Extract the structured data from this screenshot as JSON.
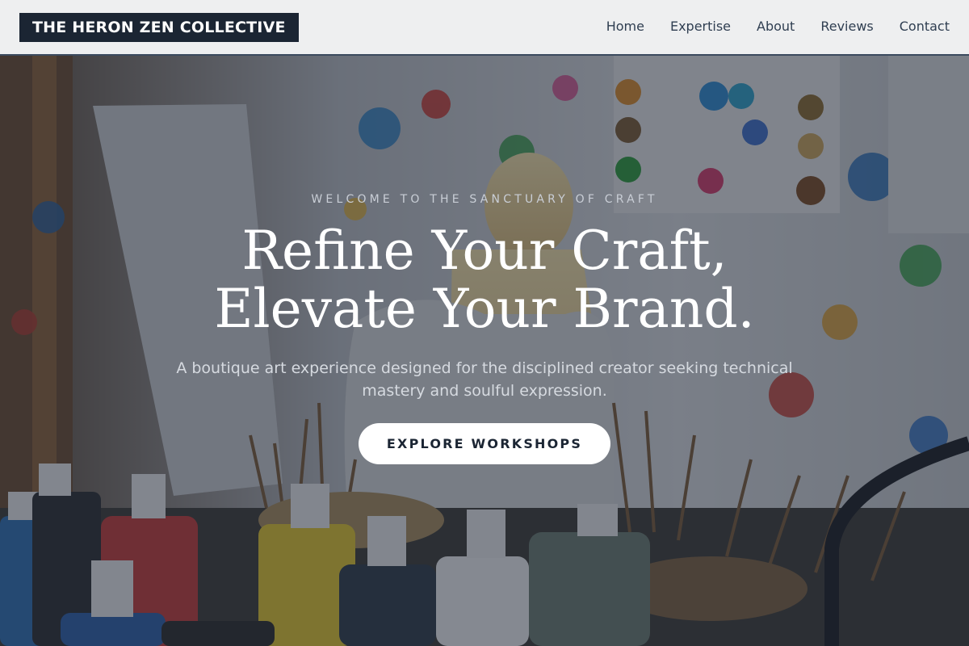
{
  "brand": {
    "name": "THE HERON ZEN COLLECTIVE"
  },
  "nav": {
    "items": [
      {
        "label": "Home"
      },
      {
        "label": "Expertise"
      },
      {
        "label": "About"
      },
      {
        "label": "Reviews"
      },
      {
        "label": "Contact"
      }
    ]
  },
  "hero": {
    "eyebrow": "WELCOME TO THE SANCTUARY OF CRAFT",
    "headline_line1": "Refine Your Craft,",
    "headline_line2": "Elevate Your Brand.",
    "subtitle": "A boutique art experience designed for the disciplined creator seeking technical mastery and soulful expression.",
    "cta_label": "EXPLORE WORKSHOPS",
    "background_image": "art-studio-paint-bottles-brushes"
  },
  "colors": {
    "brand_dark": "#1b2533",
    "header_bg": "#eeeff0",
    "nav_text": "#2f3e51",
    "cta_bg": "#ffffff"
  }
}
